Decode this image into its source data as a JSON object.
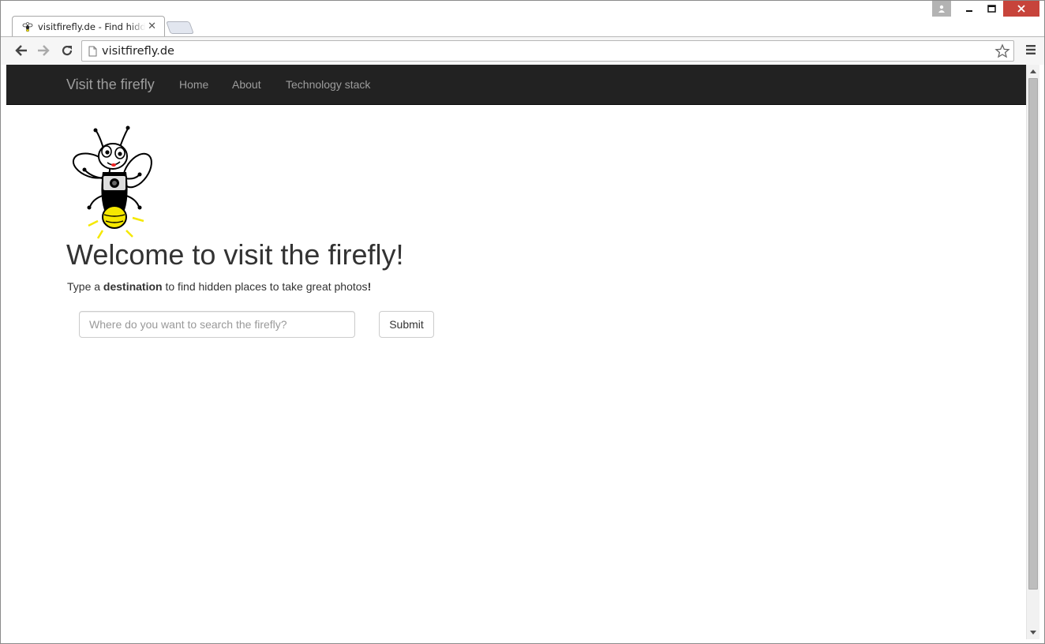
{
  "browser": {
    "tab": {
      "title": "visitfirefly.de - Find hidden places to take great photos",
      "favicon": "firefly-icon"
    },
    "address_bar": {
      "url": "visitfirefly.de"
    },
    "icons": {
      "back": "back-arrow-icon",
      "forward": "forward-arrow-icon",
      "reload": "reload-icon",
      "bookmark": "star-icon",
      "menu": "hamburger-menu-icon",
      "profile": "person-icon",
      "minimize": "minimize-icon",
      "maximize": "maximize-icon",
      "close": "close-icon"
    },
    "close_color": "#c7443b"
  },
  "navbar": {
    "brand": "Visit the firefly",
    "links": [
      "Home",
      "About",
      "Technology stack"
    ],
    "background": "#222222",
    "text_color": "#9d9d9d"
  },
  "main": {
    "logo": "firefly-mascot-with-camera",
    "headline": "Welcome to visit the firefly!",
    "lead": {
      "prefix": "Type a ",
      "bold": "destination",
      "suffix": " to find hidden places to take great photos",
      "ending": "!"
    },
    "search": {
      "placeholder": "Where do you want to search the firefly?",
      "value": ""
    },
    "submit_label": "Submit"
  }
}
